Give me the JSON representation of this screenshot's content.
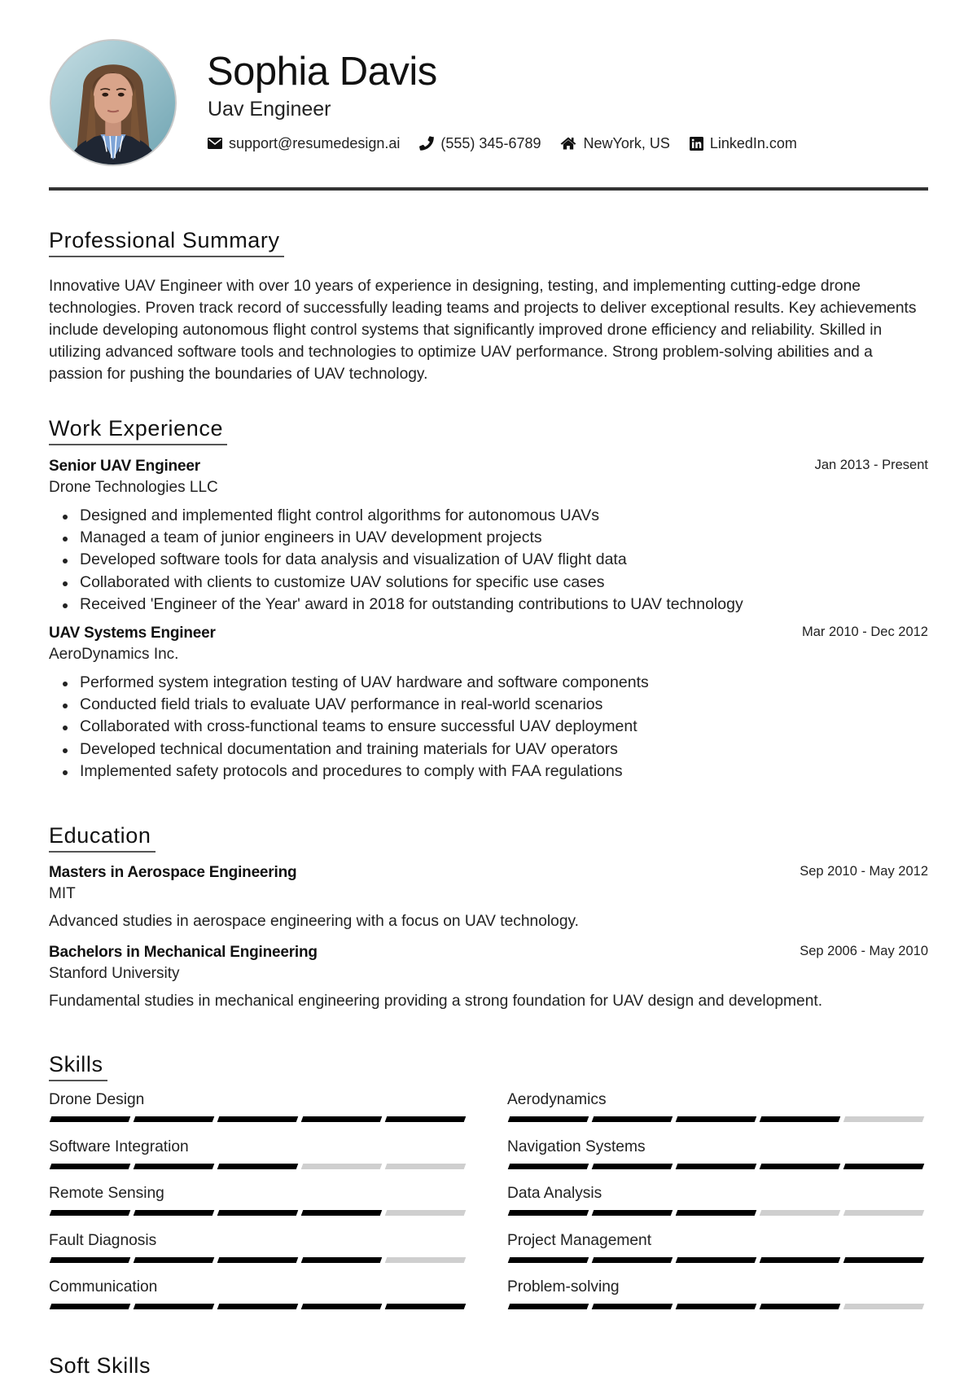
{
  "profile": {
    "name": "Sophia Davis",
    "title": "Uav Engineer",
    "photo_icon": "profile-photo",
    "contacts": [
      {
        "icon": "envelope-icon",
        "text": "support@resumedesign.ai"
      },
      {
        "icon": "phone-icon",
        "text": "(555) 345-6789"
      },
      {
        "icon": "home-icon",
        "text": "NewYork, US"
      },
      {
        "icon": "linkedin-icon",
        "text": "LinkedIn.com"
      }
    ]
  },
  "sections": {
    "summary": "Professional Summary",
    "work": "Work Experience",
    "education": "Education",
    "skills": "Skills",
    "soft_skills": "Soft Skills"
  },
  "summary": "Innovative UAV Engineer with over 10 years of experience in designing, testing, and implementing cutting-edge drone technologies. Proven track record of successfully leading teams and projects to deliver exceptional results. Key achievements include developing autonomous flight control systems that significantly improved drone efficiency and reliability. Skilled in utilizing advanced software tools and technologies to optimize UAV performance. Strong problem-solving abilities and a passion for pushing the boundaries of UAV technology.",
  "work": [
    {
      "title": "Senior UAV Engineer",
      "company": "Drone Technologies LLC",
      "date": "Jan 2013 - Present",
      "bullets": [
        "Designed and implemented flight control algorithms for autonomous UAVs",
        "Managed a team of junior engineers in UAV development projects",
        "Developed software tools for data analysis and visualization of UAV flight data",
        "Collaborated with clients to customize UAV solutions for specific use cases",
        "Received 'Engineer of the Year' award in 2018 for outstanding contributions to UAV technology"
      ]
    },
    {
      "title": "UAV Systems Engineer",
      "company": "AeroDynamics Inc.",
      "date": "Mar 2010 - Dec 2012",
      "bullets": [
        "Performed system integration testing of UAV hardware and software components",
        "Conducted field trials to evaluate UAV performance in real-world scenarios",
        "Collaborated with cross-functional teams to ensure successful UAV deployment",
        "Developed technical documentation and training materials for UAV operators",
        "Implemented safety protocols and procedures to comply with FAA regulations"
      ]
    }
  ],
  "education": [
    {
      "degree": "Masters in Aerospace Engineering",
      "school": "MIT",
      "date": "Sep 2010 - May 2012",
      "description": "Advanced studies in aerospace engineering with a focus on UAV technology."
    },
    {
      "degree": "Bachelors in Mechanical Engineering",
      "school": "Stanford University",
      "date": "Sep 2006 - May 2010",
      "description": "Fundamental studies in mechanical engineering providing a strong foundation for UAV design and development."
    }
  ],
  "skills_max": 5,
  "skills": [
    {
      "name": "Drone Design",
      "level": 5
    },
    {
      "name": "Aerodynamics",
      "level": 4
    },
    {
      "name": "Software Integration",
      "level": 3
    },
    {
      "name": "Navigation Systems",
      "level": 5
    },
    {
      "name": "Remote Sensing",
      "level": 4
    },
    {
      "name": "Data Analysis",
      "level": 3
    },
    {
      "name": "Fault Diagnosis",
      "level": 4
    },
    {
      "name": "Project Management",
      "level": 5
    },
    {
      "name": "Communication",
      "level": 5
    },
    {
      "name": "Problem-solving",
      "level": 4
    }
  ]
}
